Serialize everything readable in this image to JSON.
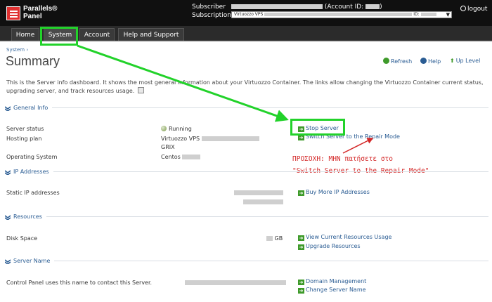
{
  "header": {
    "logo_line1": "Parallels®",
    "logo_line2": "Panel",
    "subscriber_label": "Subscriber",
    "subscription_label": "Subscription",
    "account_id_label": "(Account ID:",
    "account_id_close": ")",
    "subscription_select": {
      "prefix": "Virtuozzo VPS",
      "id_label": "ID:"
    },
    "logout_label": "logout"
  },
  "nav": {
    "tabs": [
      {
        "label": "Home"
      },
      {
        "label": "System"
      },
      {
        "label": "Account"
      },
      {
        "label": "Help and Support"
      }
    ]
  },
  "breadcrumb": "System ›",
  "page_title": "Summary",
  "page_actions": {
    "refresh": "Refresh",
    "help": "Help",
    "up_level": "Up Level"
  },
  "description": "This is the Server info dashboard. It shows the most general information about your Virtuozzo Container. The links allow changing the Virtuozzo Container current status, upgrading server, and track resources usage.",
  "sections": {
    "general_info": {
      "title": "General Info",
      "server_status_label": "Server status",
      "server_status_value": "Running",
      "hosting_plan_label": "Hosting plan",
      "hosting_plan_line1": "Virtuozzo VPS",
      "hosting_plan_line2": "GRIX",
      "os_label": "Operating System",
      "os_value": "Centos",
      "stop_server_link": "Stop Server",
      "repair_mode_link": "Switch Server to the Repair Mode"
    },
    "ip_addresses": {
      "title": "IP Addresses",
      "static_ip_label": "Static IP addresses",
      "buy_more_link": "Buy More IP Addresses"
    },
    "resources": {
      "title": "Resources",
      "disk_space_label": "Disk Space",
      "disk_unit": "GB",
      "view_usage_link": "View Current Resources Usage",
      "upgrade_link": "Upgrade Resources"
    },
    "server_name": {
      "title": "Server Name",
      "control_panel_label": "Control Panel uses this name to contact this Server.",
      "domain_management_link": "Domain Management",
      "change_name_link": "Change Server Name"
    }
  },
  "annotation": {
    "line1": "ΠΡΟΣΟΧΗ: ΜΗΝ πατήσετε στο",
    "line2": "\"Switch Server to the Repair Mode\""
  },
  "colors": {
    "highlight": "#22d22a",
    "arrow_green": "#22d22a",
    "arrow_red": "#d42828",
    "link_blue": "#2a5c93",
    "header_bg": "#101010"
  }
}
